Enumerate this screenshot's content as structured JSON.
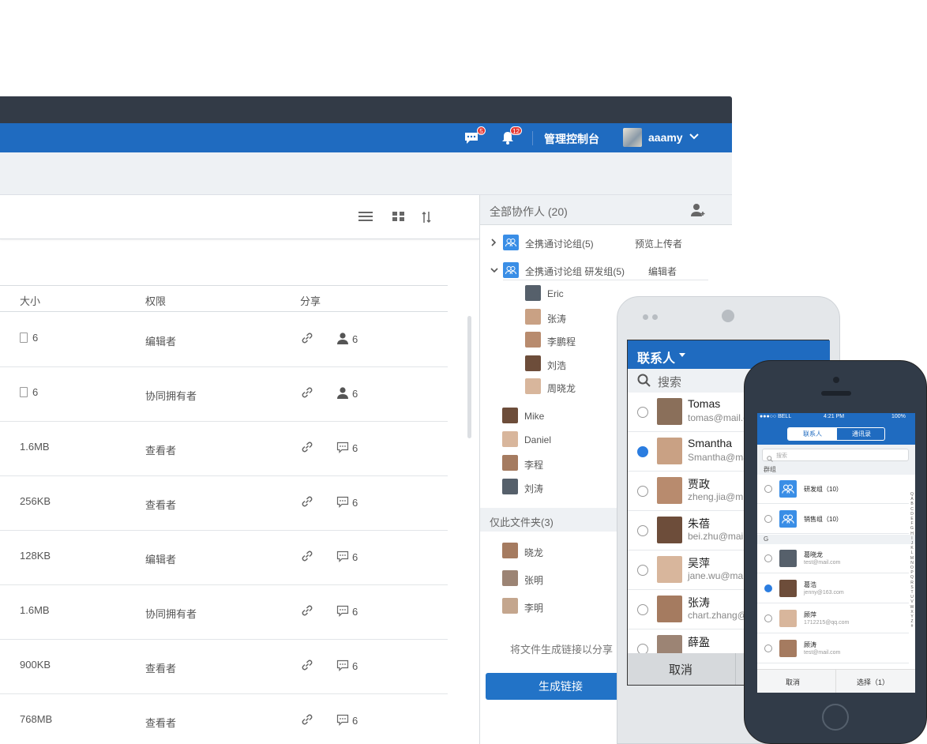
{
  "nav": {
    "messages_badge": "5",
    "alerts_badge": "12",
    "console_label": "管理控制台",
    "username": "aaamy"
  },
  "table": {
    "columns": [
      "大小",
      "权限",
      "分享"
    ],
    "rows": [
      {
        "size": "6",
        "is_file": true,
        "permission": "编辑者",
        "share_type": "user",
        "count": "6"
      },
      {
        "size": "6",
        "is_file": true,
        "permission": "协同拥有者",
        "share_type": "user",
        "count": "6"
      },
      {
        "size": "1.6MB",
        "is_file": false,
        "permission": "查看者",
        "share_type": "comment",
        "count": "6"
      },
      {
        "size": "256KB",
        "is_file": false,
        "permission": "查看者",
        "share_type": "comment",
        "count": "6"
      },
      {
        "size": "128KB",
        "is_file": false,
        "permission": "编辑者",
        "share_type": "comment",
        "count": "6"
      },
      {
        "size": "1.6MB",
        "is_file": false,
        "permission": "协同拥有者",
        "share_type": "comment",
        "count": "6"
      },
      {
        "size": "900KB",
        "is_file": false,
        "permission": "查看者",
        "share_type": "comment",
        "count": "6"
      },
      {
        "size": "768MB",
        "is_file": false,
        "permission": "查看者",
        "share_type": "comment",
        "count": "6"
      }
    ]
  },
  "collaborators": {
    "title": "全部协作人 (20)",
    "groups": [
      {
        "name": "全携通讨论组(5)",
        "role": "预览上传者"
      },
      {
        "name": "全携通讨论组 研发组(5)",
        "role": "编辑者"
      }
    ],
    "group_members": [
      "Eric",
      "张涛",
      "李鹏程",
      "刘浩",
      "周晓龙"
    ],
    "members": [
      "Mike",
      "Daniel",
      "李程",
      "刘涛"
    ],
    "folder_only_title": "仅此文件夹(3)",
    "folder_only": [
      "晓龙",
      "张明",
      "李明"
    ],
    "footer_text": "将文件生成链接以分享",
    "generate_label": "生成链接"
  },
  "android": {
    "title": "联系人",
    "search_placeholder": "搜索",
    "contacts": [
      {
        "name": "Tomas",
        "email": "tomas@mail.c",
        "checked": false
      },
      {
        "name": "Smantha",
        "email": "Smantha@ma",
        "checked": true
      },
      {
        "name": "贾政",
        "email": "zheng.jia@m",
        "checked": false
      },
      {
        "name": "朱蓓",
        "email": "bei.zhu@mail.",
        "checked": false
      },
      {
        "name": "吴萍",
        "email": "jane.wu@mail.",
        "checked": false
      },
      {
        "name": "张涛",
        "email": "chart.zhang@",
        "checked": false
      },
      {
        "name": "薛盈",
        "email": "",
        "checked": false
      }
    ],
    "cancel": "取消"
  },
  "iphone": {
    "carrier": "●●●○○ BELL",
    "time": "4:21 PM",
    "battery": "100%",
    "tab_contacts": "联系人",
    "tab_addressbook": "通讯录",
    "search_placeholder": "搜索",
    "section_groups": "群组",
    "groups": [
      "研发组（10）",
      "销售组（10）"
    ],
    "section_g": "G",
    "contacts": [
      {
        "name": "葛晓龙",
        "email": "test@mail.com",
        "checked": false
      },
      {
        "name": "葛浩",
        "email": "jenny@163.com",
        "checked": true
      },
      {
        "name": "顾萍",
        "email": "1712215@qq.com",
        "checked": false
      },
      {
        "name": "顾涛",
        "email": "test@mail.com",
        "checked": false
      }
    ],
    "index_letters": "QABCDEFGHIJKLMNOPQRSTUVWXYZ#",
    "cancel": "取消",
    "select": "选择（1）"
  },
  "colors": {
    "brand": "#1f6bc0",
    "titlebar": "#333b47",
    "accent": "#2b7de0"
  }
}
